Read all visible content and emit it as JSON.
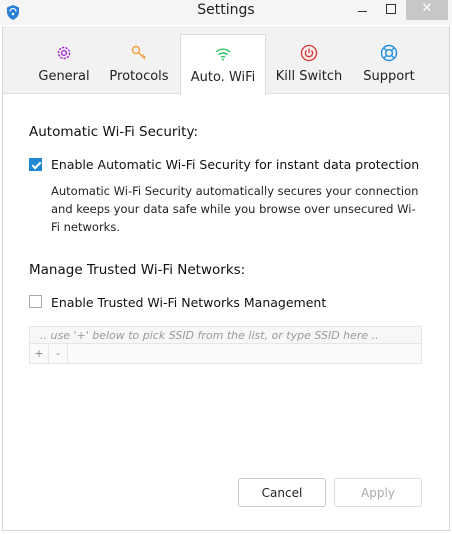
{
  "window": {
    "title": "Settings",
    "close_glyph": "✕"
  },
  "tabs": [
    {
      "label": "General",
      "icon": "gear-icon",
      "color": "#a020d0"
    },
    {
      "label": "Protocols",
      "icon": "key-icon",
      "color": "#f0a040"
    },
    {
      "label": "Auto. WiFi",
      "icon": "wifi-icon",
      "color": "#30c060",
      "active": true
    },
    {
      "label": "Kill Switch",
      "icon": "power-icon",
      "color": "#e03030"
    },
    {
      "label": "Support",
      "icon": "lifebuoy-icon",
      "color": "#2090e0"
    }
  ],
  "auto_wifi": {
    "heading": "Automatic Wi-Fi Security:",
    "enable_label": "Enable Automatic Wi-Fi Security for instant data protection",
    "enabled": true,
    "description": "Automatic Wi-Fi Security automatically secures your connection and keeps your data safe while you browse over unsecured Wi-Fi networks."
  },
  "trusted": {
    "heading": "Manage Trusted Wi-Fi Networks:",
    "enable_label": "Enable Trusted Wi-Fi Networks Management",
    "enabled": false,
    "placeholder": ".. use '+' below to pick SSID from the list, or type SSID here ..",
    "add_label": "+",
    "remove_label": "-"
  },
  "buttons": {
    "cancel": "Cancel",
    "apply": "Apply"
  },
  "colors": {
    "accent": "#1e88d2"
  }
}
